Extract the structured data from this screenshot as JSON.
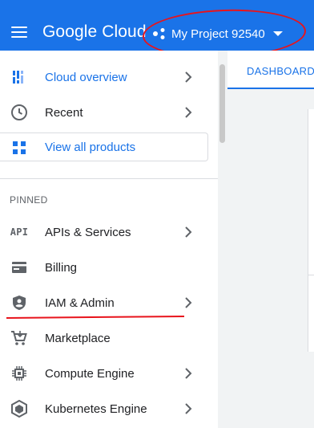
{
  "header": {
    "brand": "Google Cloud",
    "project_name": "My Project 92540"
  },
  "sidebar": {
    "top_items": [
      {
        "label": "Cloud overview",
        "icon": "dashboard-icon",
        "has_chevron": true
      },
      {
        "label": "Recent",
        "icon": "clock-icon",
        "has_chevron": true
      }
    ],
    "view_all": {
      "label": "View all products",
      "icon": "grid-icon"
    },
    "section_label": "PINNED",
    "pinned_items": [
      {
        "label": "APIs & Services",
        "icon": "api-icon",
        "icon_text": "API",
        "has_chevron": true
      },
      {
        "label": "Billing",
        "icon": "billing-icon",
        "has_chevron": false
      },
      {
        "label": "IAM & Admin",
        "icon": "shield-icon",
        "has_chevron": true
      },
      {
        "label": "Marketplace",
        "icon": "cart-icon",
        "has_chevron": false
      },
      {
        "label": "Compute Engine",
        "icon": "chip-icon",
        "has_chevron": true
      },
      {
        "label": "Kubernetes Engine",
        "icon": "hexagon-icon",
        "has_chevron": true
      }
    ]
  },
  "main": {
    "tab_label": "DASHBOARD"
  },
  "colors": {
    "header_blue": "#1a73e8",
    "annotation_red": "#e8141c",
    "icon_gray": "#5f6368",
    "link_blue": "#1a73e8"
  }
}
